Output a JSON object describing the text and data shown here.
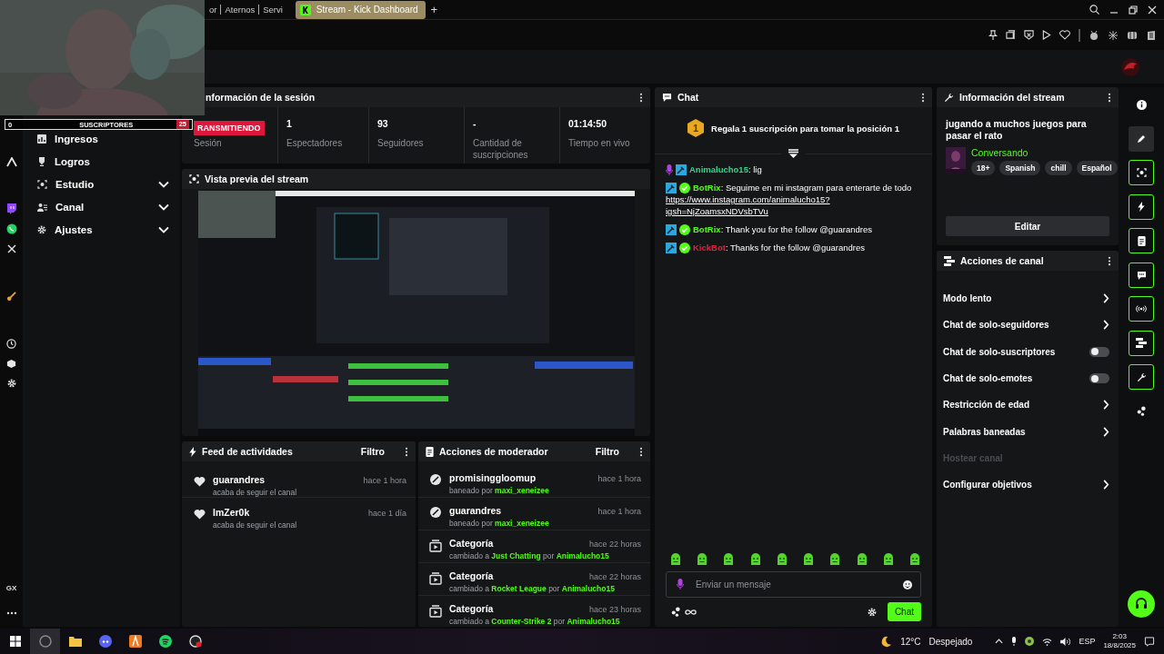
{
  "browser": {
    "tabs": [
      {
        "label": "or",
        "selected": false
      },
      {
        "label": "Aternos",
        "selected": false
      },
      {
        "label": "Servi",
        "selected": false
      },
      {
        "label": "Stream - Kick Dashboard",
        "selected": true
      }
    ],
    "new_tab": "+"
  },
  "overlay": {
    "count": "0",
    "label": "SUSCRIPTORES",
    "goal": "25"
  },
  "sidebar": {
    "badge": "GX"
  },
  "nav": [
    {
      "label": "Ingresos",
      "has_submenu": false
    },
    {
      "label": "Logros",
      "has_submenu": false
    },
    {
      "label": "Estudio",
      "has_submenu": true
    },
    {
      "label": "Canal",
      "has_submenu": true
    },
    {
      "label": "Ajustes",
      "has_submenu": true
    }
  ],
  "session": {
    "title": "nformación de la sesión",
    "stats": [
      {
        "kind": "badge",
        "value": "RANSMITIENDO",
        "label": "Sesión"
      },
      {
        "kind": "stat",
        "value": "1",
        "label": "Espectadores"
      },
      {
        "kind": "stat",
        "value": "93",
        "label": "Seguidores"
      },
      {
        "kind": "stat",
        "value": "-",
        "label": "Cantidad de suscripciones"
      },
      {
        "kind": "stat",
        "value": "01:14:50",
        "label": "Tiempo en vivo"
      }
    ]
  },
  "preview": {
    "title": "Vista previa del stream"
  },
  "activity_feed": {
    "title": "Feed de actividades",
    "filter": "Filtro",
    "items": [
      {
        "user": "guarandres",
        "time": "hace 1 hora",
        "text": "acaba de seguir el canal"
      },
      {
        "user": "ImZer0k",
        "time": "hace 1 día",
        "text": "acaba de seguir el canal"
      }
    ]
  },
  "mod_actions": {
    "title": "Acciones de moderador",
    "filter": "Filtro",
    "items": [
      {
        "kind": "ban",
        "title": "promisinggloomup",
        "time": "hace 1 hora",
        "detail": [
          {
            "text": "baneado por ",
            "highlight": false
          },
          {
            "text": "maxi_xeneizee",
            "highlight": true
          }
        ]
      },
      {
        "kind": "ban",
        "title": "guarandres",
        "time": "hace 1 hora",
        "detail": [
          {
            "text": "baneado por ",
            "highlight": false
          },
          {
            "text": "maxi_xeneizee",
            "highlight": true
          }
        ]
      },
      {
        "kind": "category",
        "title": "Categoría",
        "time": "hace 22 horas",
        "detail": [
          {
            "text": "cambiado a ",
            "highlight": false
          },
          {
            "text": "Just Chatting",
            "highlight": true
          },
          {
            "text": " por ",
            "highlight": false
          },
          {
            "text": "Animalucho15",
            "highlight": true
          }
        ]
      },
      {
        "kind": "category",
        "title": "Categoría",
        "time": "hace 22 horas",
        "detail": [
          {
            "text": "cambiado a ",
            "highlight": false
          },
          {
            "text": "Rocket League",
            "highlight": true
          },
          {
            "text": " por ",
            "highlight": false
          },
          {
            "text": "Animalucho15",
            "highlight": true
          }
        ]
      },
      {
        "kind": "category",
        "title": "Categoría",
        "time": "hace 23 horas",
        "detail": [
          {
            "text": "cambiado a ",
            "highlight": false
          },
          {
            "text": "Counter-Strike 2",
            "highlight": true
          },
          {
            "text": " por ",
            "highlight": false
          },
          {
            "text": "Animalucho15",
            "highlight": true
          }
        ]
      }
    ]
  },
  "chat": {
    "title": "Chat",
    "gift": {
      "rank": "1",
      "text": "Regala 1 suscripción para tomar la posición 1"
    },
    "messages": [
      {
        "kind": "streamer",
        "user": "Animalucho15",
        "color": "#2ed889",
        "text": ": lig"
      },
      {
        "kind": "bot",
        "user": "BotRix",
        "color": "#53fc18",
        "text": ": Seguime en mi instagram para enterarte de todo",
        "link": "https://www.instagram.com/animalucho15?igsh=NjZoamsxNDVsbTVu"
      },
      {
        "kind": "bot",
        "user": "BotRix",
        "color": "#53fc18",
        "text": ": Thank you for the follow @guarandres"
      },
      {
        "kind": "bot",
        "user": "KickBot",
        "color": "#e0223c",
        "text": ": Thanks for the follow @guarandres"
      }
    ],
    "input": {
      "placeholder": "Enviar un mensaje"
    },
    "send": "Chat"
  },
  "stream_info": {
    "title": "Información del stream",
    "stream_title": "jugando a muchos juegos para pasar el rato",
    "category": "Conversando",
    "tags": [
      "18+",
      "Spanish",
      "chill",
      "Español"
    ],
    "edit": "Editar"
  },
  "channel_actions": {
    "title": "Acciones de canal",
    "items": [
      {
        "label": "Modo lento",
        "kind": "submenu",
        "disabled": false
      },
      {
        "label": "Chat de solo-seguidores",
        "kind": "submenu",
        "disabled": false
      },
      {
        "label": "Chat de solo-suscriptores",
        "kind": "toggle",
        "on": false,
        "disabled": false
      },
      {
        "label": "Chat de solo-emotes",
        "kind": "toggle",
        "on": false,
        "disabled": false
      },
      {
        "label": "Restricción de edad",
        "kind": "submenu",
        "disabled": false
      },
      {
        "label": "Palabras baneadas",
        "kind": "submenu",
        "disabled": false
      },
      {
        "label": "Hostear canal",
        "kind": "plain",
        "disabled": true
      },
      {
        "label": "Configurar objetivos",
        "kind": "submenu",
        "disabled": false
      }
    ]
  },
  "rail": [
    {
      "kind": "info",
      "active": false
    },
    {
      "kind": "edit",
      "active": false
    },
    {
      "kind": "preview",
      "active": true
    },
    {
      "kind": "feed",
      "active": true
    },
    {
      "kind": "mod",
      "active": true
    },
    {
      "kind": "chat",
      "active": true
    },
    {
      "kind": "session",
      "active": true
    },
    {
      "kind": "actions",
      "active": true
    },
    {
      "kind": "stream",
      "active": true
    },
    {
      "kind": "more",
      "active": false
    }
  ],
  "taskbar": {
    "temperature": "12°C",
    "weather": "Despejado",
    "language": "ESP",
    "time": "2:03",
    "date": "18/8/2025"
  }
}
